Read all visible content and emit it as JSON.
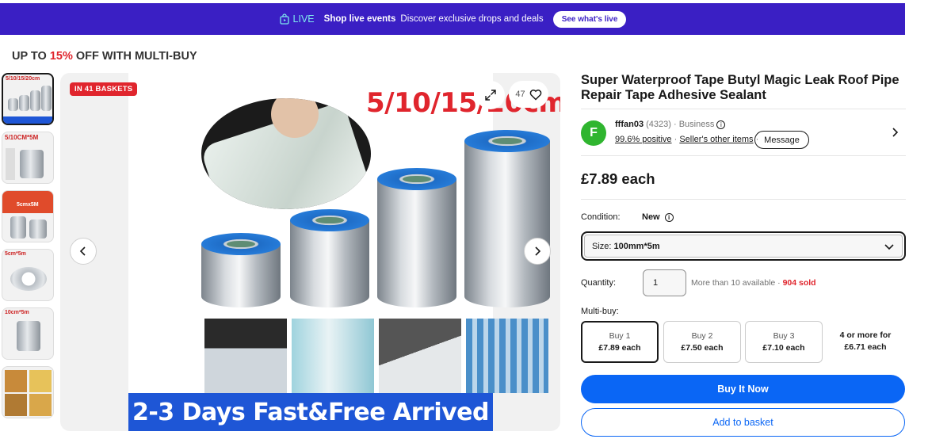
{
  "live_banner": {
    "tag": "LIVE",
    "title": "Shop live events",
    "text": "Discover exclusive drops and deals",
    "button": "See what's live"
  },
  "promo": {
    "prefix": "UP TO ",
    "percent": "15%",
    "suffix": " OFF WITH MULTI-BUY"
  },
  "thumbnails": {
    "t1_label": "5/10/15/20cm",
    "t2_label": "5/10CM*5M",
    "t3_label": "5cmx5M",
    "t4_label": "5cm*5m",
    "t5_label": "10cm*5m"
  },
  "gallery": {
    "badge": "IN 41 BASKETS",
    "hero_title": "5/10/15/20cm",
    "bottom_banner": "2-3 Days Fast&Free Arrived",
    "watch_count": "47",
    "prev_icon": "chevron-left",
    "next_icon": "chevron-right",
    "expand_icon": "expand-arrows",
    "heart_icon": "heart-outline"
  },
  "product": {
    "title": "Super Waterproof Tape Butyl Magic Leak Roof Pipe Repair Tape Adhesive Sealant",
    "price": "£7.89 each"
  },
  "seller": {
    "avatar_letter": "F",
    "name": "fffan03",
    "feedback_count": "(4323)",
    "type": "· Business",
    "positive": "99.6% positive",
    "other_items": "Seller's other items",
    "message_button": "Message"
  },
  "condition": {
    "label": "Condition:",
    "value": "New"
  },
  "size": {
    "label": "Size:",
    "value": "100mm*5m"
  },
  "quantity": {
    "label": "Quantity:",
    "value": "1",
    "available": "More than 10 available · ",
    "sold": "904 sold"
  },
  "multibuy": {
    "label": "Multi-buy:",
    "tiers": [
      {
        "qty": "Buy 1",
        "price": "£7.89 each"
      },
      {
        "qty": "Buy 2",
        "price": "£7.50 each"
      },
      {
        "qty": "Buy 3",
        "price": "£7.10 each"
      }
    ],
    "more_line1": "4 or more for",
    "more_line2": "£6.71 each"
  },
  "actions": {
    "buy_now": "Buy It Now",
    "add_to_basket": "Add to basket"
  },
  "colors": {
    "banner_bg": "#3a1fc4",
    "accent_blue": "#0a66f5",
    "sale_red": "#e0252d",
    "avatar_green": "#2fb52f"
  }
}
